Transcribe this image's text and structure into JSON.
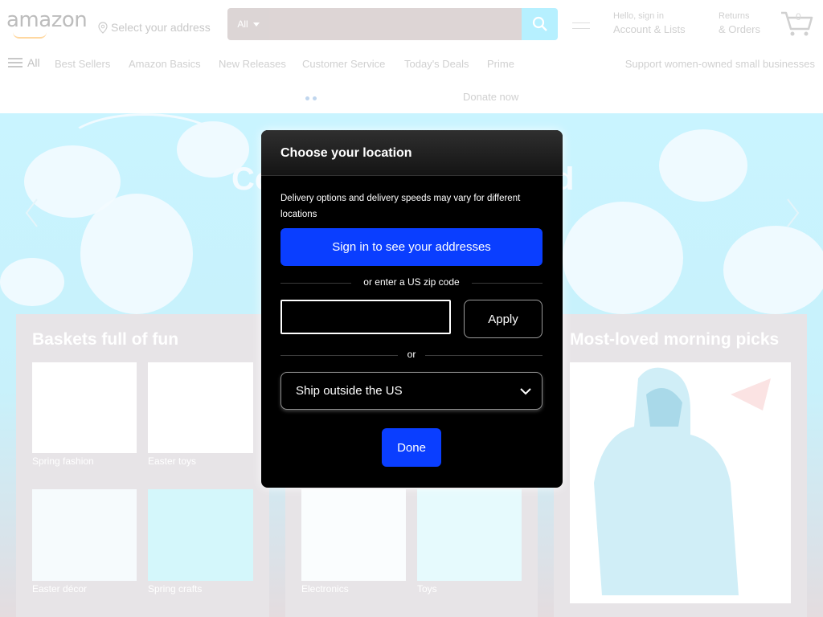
{
  "header": {
    "logo_text": "amazon",
    "address_label": "Select your address",
    "search_category": "All",
    "search_placeholder": "",
    "account_line1": "Hello, sign in",
    "account_line2": "Account & Lists",
    "orders_line1": "Returns",
    "orders_line2": "& Orders",
    "cart_count": "0"
  },
  "nav": {
    "all_label": "All",
    "links": [
      "Best Sellers",
      "Amazon Basics",
      "New Releases",
      "Customer Service",
      "Today's Deals",
      "Prime"
    ],
    "promo": "Support women-owned small businesses"
  },
  "donate": {
    "text": "Donate now"
  },
  "hero": {
    "title_left": "Co",
    "title_right": "d"
  },
  "cards": [
    {
      "title": "Baskets full of fun",
      "tiles": [
        "Spring fashion",
        "Easter toys",
        "Easter décor",
        "Spring crafts"
      ]
    },
    {
      "title": "",
      "tiles": [
        "Electronics",
        "Toys"
      ]
    },
    {
      "title": "Most-loved morning picks"
    }
  ],
  "modal": {
    "title": "Choose your location",
    "description": "Delivery options and delivery speeds may vary for different locations",
    "signin_label": "Sign in to see your addresses",
    "zip_divider": "or enter a US zip code",
    "zip_value": "",
    "apply_label": "Apply",
    "or_divider": "or",
    "ship_option": "Ship outside the US",
    "done_label": "Done"
  },
  "colors": {
    "modal_bg": "#000000",
    "primary_button": "#0a3eff",
    "hero_bg": "#c9f4ff"
  }
}
